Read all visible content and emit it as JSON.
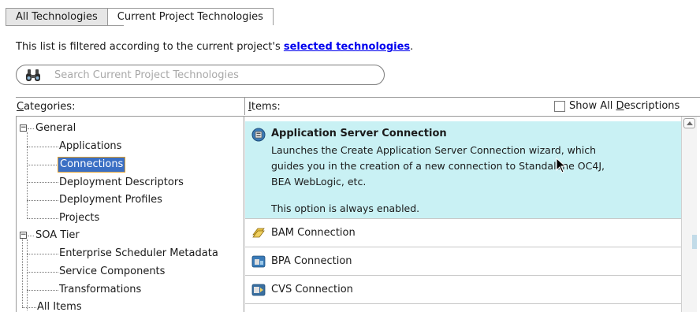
{
  "tabs": [
    {
      "label": "All Technologies",
      "active": false
    },
    {
      "label": "Current Project Technologies",
      "active": true
    }
  ],
  "filter_notice": {
    "prefix": "This list is filtered according to the current project's ",
    "link": "selected technologies",
    "suffix": "."
  },
  "search": {
    "placeholder": "Search Current Project Technologies",
    "value": ""
  },
  "categories_panel": {
    "header_mnemonic": "C",
    "header_rest": "ategories:",
    "tree": [
      {
        "label": "General",
        "expanded": true,
        "children": [
          {
            "label": "Applications"
          },
          {
            "label": "Connections",
            "selected": true
          },
          {
            "label": "Deployment Descriptors"
          },
          {
            "label": "Deployment Profiles"
          },
          {
            "label": "Projects"
          }
        ]
      },
      {
        "label": "SOA Tier",
        "expanded": true,
        "children": [
          {
            "label": "Enterprise Scheduler Metadata"
          },
          {
            "label": "Service Components"
          },
          {
            "label": "Transformations"
          }
        ]
      },
      {
        "label": "All Items"
      }
    ]
  },
  "items_panel": {
    "header_mnemonic": "I",
    "header_rest": "tems:",
    "show_all": {
      "prefix": "Show All ",
      "mnemonic": "D",
      "rest": "escriptions",
      "checked": false
    },
    "items": [
      {
        "name": "Application Server Connection",
        "selected": true,
        "icon": "app-server-connection-icon",
        "description": [
          "Launches the Create Application Server Connection wizard, which",
          "guides you in the creation of a new connection to Standalone OC4J,",
          "BEA WebLogic, etc.",
          "",
          "This option is always enabled."
        ]
      },
      {
        "name": "BAM Connection",
        "icon": "bam-connection-icon"
      },
      {
        "name": "BPA Connection",
        "icon": "bpa-connection-icon"
      },
      {
        "name": "CVS Connection",
        "icon": "cvs-connection-icon"
      }
    ]
  },
  "colors": {
    "selected_item_bg": "#c9f1f4",
    "selected_node_bg": "#3a6fc4",
    "link": "#0000ee"
  }
}
